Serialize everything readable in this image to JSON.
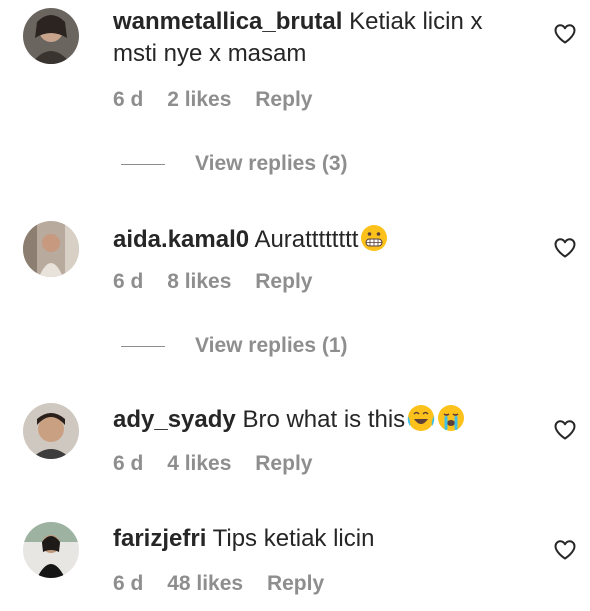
{
  "comments": [
    {
      "username": "wanmetallica_brutal",
      "text": "Ketiak licin x msti nye x masam",
      "time": "6 d",
      "likes": "2 likes",
      "reply_label": "Reply",
      "view_replies": "View replies (3)"
    },
    {
      "username": "aida.kamal0",
      "text": "Auratttttttt",
      "emoji": [
        "grimacing-face"
      ],
      "time": "6 d",
      "likes": "8 likes",
      "reply_label": "Reply",
      "view_replies": "View replies (1)"
    },
    {
      "username": "ady_syady",
      "text": "Bro what is this",
      "emoji": [
        "tears-of-joy-face",
        "loudly-crying-face"
      ],
      "time": "6 d",
      "likes": "4 likes",
      "reply_label": "Reply"
    },
    {
      "username": "farizjefri",
      "text": "Tips ketiak licin",
      "time": "6 d",
      "likes": "48 likes",
      "reply_label": "Reply"
    }
  ],
  "icons": {
    "like": "heart-outline-icon"
  },
  "colors": {
    "text": "#262626",
    "secondary": "#8e8e8e",
    "background": "#ffffff"
  }
}
